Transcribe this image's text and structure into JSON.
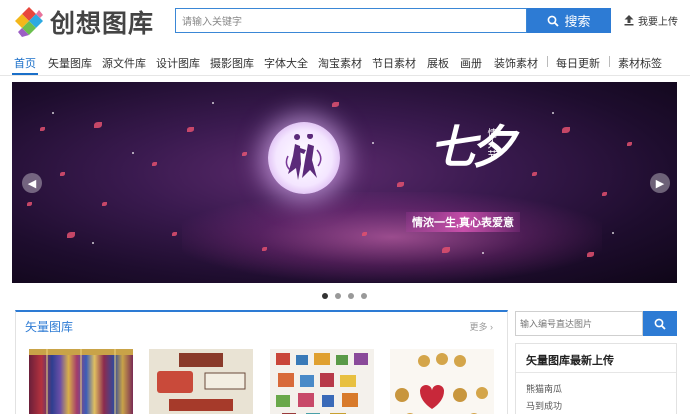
{
  "header": {
    "logo_text": "创想图库",
    "search_placeholder": "请输入关键字",
    "search_button": "搜索",
    "upload_label": "我要上传"
  },
  "nav": {
    "items": [
      "首页",
      "矢量图库",
      "源文件库",
      "设计图库",
      "摄影图库",
      "字体大全",
      "淘宝素材",
      "节日素材",
      "展板",
      "画册",
      "装饰素材",
      "每日更新",
      "素材标签"
    ]
  },
  "banner": {
    "title": "七夕",
    "subtitle": "情人节",
    "slogan": "情浓一生,真心表爱意",
    "slide_count": 4,
    "active_slide": 1
  },
  "section": {
    "title": "矢量图库",
    "more": "更多"
  },
  "sidebar": {
    "search_placeholder": "输入编号直达图片",
    "box_title": "矢量图库最新上传",
    "items": [
      "熊猫南瓜",
      "马到成功"
    ]
  },
  "colors": {
    "accent": "#2d7bd4",
    "banner_bg": "#2a1240"
  }
}
